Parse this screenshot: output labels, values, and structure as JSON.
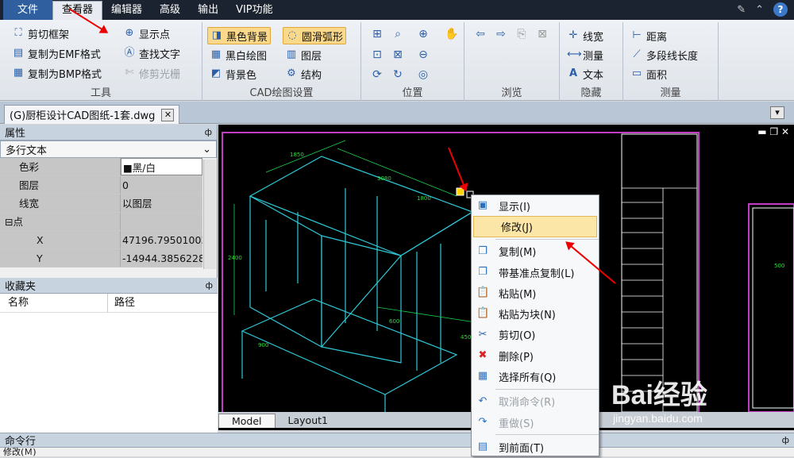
{
  "menu": {
    "file": "文件",
    "viewer": "查看器",
    "editor": "编辑器",
    "advanced": "高级",
    "output": "输出",
    "vip": "VIP功能"
  },
  "help": "?",
  "ribbon": {
    "tools": {
      "crop": "剪切框架",
      "emf": "复制为EMF格式",
      "bmp": "复制为BMP格式",
      "showpts": "显示点",
      "findtext": "查找文字",
      "trim": "修剪光栅",
      "title": "工具"
    },
    "cadset": {
      "black": "黑色背景",
      "smooth": "圆滑弧形",
      "bw": "黑白绘图",
      "layer": "图层",
      "bgcolor": "背景色",
      "struct": "结构",
      "title": "CAD绘图设置"
    },
    "pos": {
      "title": "位置"
    },
    "browse": {
      "title": "浏览"
    },
    "hidden": {
      "lw": "线宽",
      "measure": "测量",
      "text": "文本",
      "title": "隐藏"
    },
    "measure": {
      "dist": "距离",
      "poly": "多段线长度",
      "area": "面积",
      "title": "测量"
    }
  },
  "doc": {
    "tab": "(G)厨柜设计CAD图纸-1套.dwg",
    "close": "✕"
  },
  "props": {
    "title": "属性",
    "pin": "ф",
    "type": "多行文本",
    "rows": [
      {
        "k": "色彩",
        "v": "■黑/白"
      },
      {
        "k": "图层",
        "v": "0"
      },
      {
        "k": "线宽",
        "v": "以图层"
      },
      {
        "k": "⊟点",
        "v": ""
      },
      {
        "k": "X",
        "v": "47196.795010032"
      },
      {
        "k": "Y",
        "v": "-14944.385622885"
      }
    ]
  },
  "favs": {
    "title": "收藏夹",
    "pin": "ф",
    "col1": "名称",
    "col2": "路径"
  },
  "layouts": {
    "model": "Model",
    "layout1": "Layout1"
  },
  "cmd": {
    "title": "命令行",
    "pin": "ф",
    "text": "修改(Ｍ)"
  },
  "ctx": {
    "items": [
      {
        "l": "显示(I)",
        "ic": "▣"
      },
      {
        "l": "修改(J)",
        "ic": ""
      },
      {
        "l": "复制(M)",
        "ic": "❐"
      },
      {
        "l": "带基准点复制(L)",
        "ic": "❐"
      },
      {
        "l": "粘贴(M)",
        "ic": "📋"
      },
      {
        "l": "粘贴为块(N)",
        "ic": "📋"
      },
      {
        "l": "剪切(O)",
        "ic": "✂"
      },
      {
        "l": "删除(P)",
        "ic": "✖"
      },
      {
        "l": "选择所有(Q)",
        "ic": "▦"
      },
      {
        "l": "取消命令(R)",
        "ic": "↶"
      },
      {
        "l": "重做(S)",
        "ic": "↷"
      },
      {
        "l": "到前面(T)",
        "ic": "▤"
      }
    ]
  },
  "watermark": {
    "brand": "Bai经验",
    "url": "jingyan.baidu.com"
  }
}
